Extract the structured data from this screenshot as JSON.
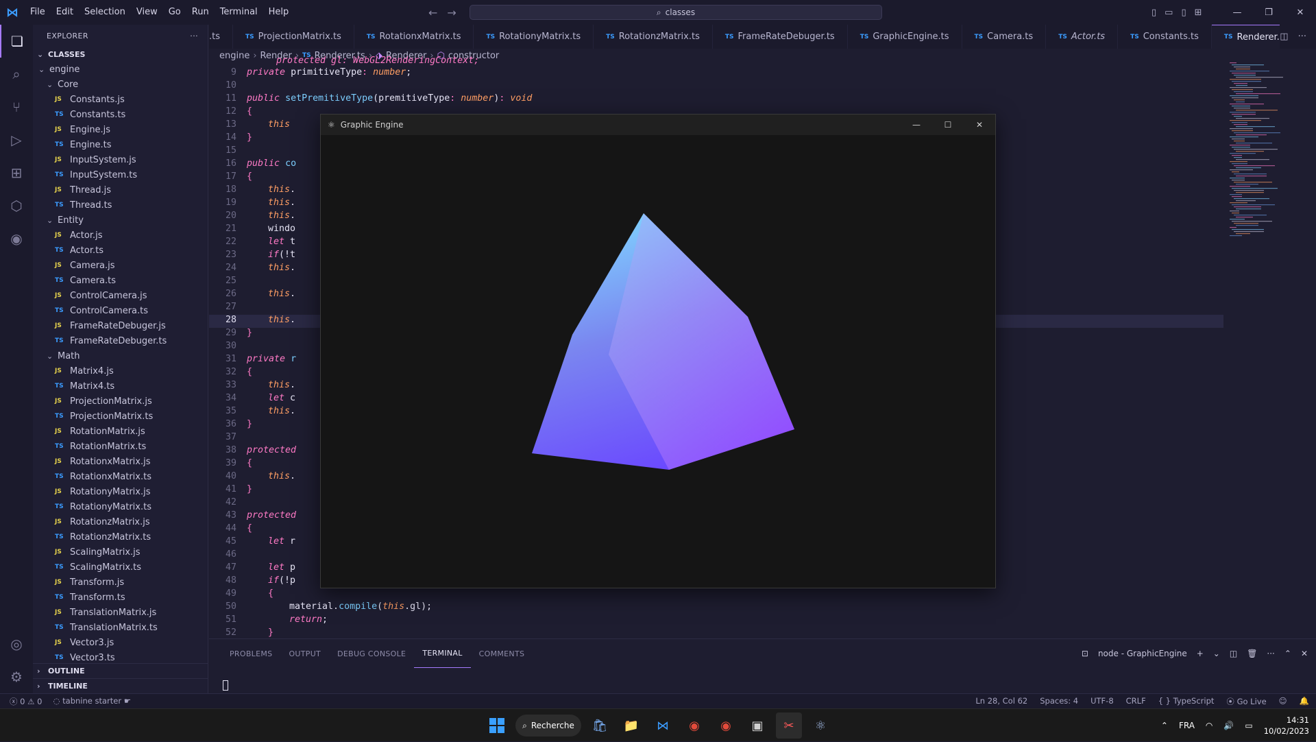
{
  "titlebar": {
    "menu": [
      "File",
      "Edit",
      "Selection",
      "View",
      "Go",
      "Run",
      "Terminal",
      "Help"
    ],
    "search": "classes"
  },
  "sidebar": {
    "title": "EXPLORER",
    "root": "CLASSES",
    "outline": "OUTLINE",
    "timeline": "TIMELINE",
    "tree": [
      {
        "type": "folder",
        "label": "engine",
        "depth": 1
      },
      {
        "type": "folder",
        "label": "Core",
        "depth": 2
      },
      {
        "type": "js",
        "label": "Constants.js",
        "depth": 3
      },
      {
        "type": "ts",
        "label": "Constants.ts",
        "depth": 3
      },
      {
        "type": "js",
        "label": "Engine.js",
        "depth": 3
      },
      {
        "type": "ts",
        "label": "Engine.ts",
        "depth": 3
      },
      {
        "type": "js",
        "label": "InputSystem.js",
        "depth": 3
      },
      {
        "type": "ts",
        "label": "InputSystem.ts",
        "depth": 3
      },
      {
        "type": "js",
        "label": "Thread.js",
        "depth": 3
      },
      {
        "type": "ts",
        "label": "Thread.ts",
        "depth": 3
      },
      {
        "type": "folder",
        "label": "Entity",
        "depth": 2
      },
      {
        "type": "js",
        "label": "Actor.js",
        "depth": 3
      },
      {
        "type": "ts",
        "label": "Actor.ts",
        "depth": 3
      },
      {
        "type": "js",
        "label": "Camera.js",
        "depth": 3
      },
      {
        "type": "ts",
        "label": "Camera.ts",
        "depth": 3
      },
      {
        "type": "js",
        "label": "ControlCamera.js",
        "depth": 3
      },
      {
        "type": "ts",
        "label": "ControlCamera.ts",
        "depth": 3
      },
      {
        "type": "js",
        "label": "FrameRateDebuger.js",
        "depth": 3
      },
      {
        "type": "ts",
        "label": "FrameRateDebuger.ts",
        "depth": 3
      },
      {
        "type": "folder",
        "label": "Math",
        "depth": 2
      },
      {
        "type": "js",
        "label": "Matrix4.js",
        "depth": 3
      },
      {
        "type": "ts",
        "label": "Matrix4.ts",
        "depth": 3
      },
      {
        "type": "js",
        "label": "ProjectionMatrix.js",
        "depth": 3
      },
      {
        "type": "ts",
        "label": "ProjectionMatrix.ts",
        "depth": 3
      },
      {
        "type": "js",
        "label": "RotationMatrix.js",
        "depth": 3
      },
      {
        "type": "ts",
        "label": "RotationMatrix.ts",
        "depth": 3
      },
      {
        "type": "js",
        "label": "RotationxMatrix.js",
        "depth": 3
      },
      {
        "type": "ts",
        "label": "RotationxMatrix.ts",
        "depth": 3
      },
      {
        "type": "js",
        "label": "RotationyMatrix.js",
        "depth": 3
      },
      {
        "type": "ts",
        "label": "RotationyMatrix.ts",
        "depth": 3
      },
      {
        "type": "js",
        "label": "RotationzMatrix.js",
        "depth": 3
      },
      {
        "type": "ts",
        "label": "RotationzMatrix.ts",
        "depth": 3
      },
      {
        "type": "js",
        "label": "ScalingMatrix.js",
        "depth": 3
      },
      {
        "type": "ts",
        "label": "ScalingMatrix.ts",
        "depth": 3
      },
      {
        "type": "js",
        "label": "Transform.js",
        "depth": 3
      },
      {
        "type": "ts",
        "label": "Transform.ts",
        "depth": 3
      },
      {
        "type": "js",
        "label": "TranslationMatrix.js",
        "depth": 3
      },
      {
        "type": "ts",
        "label": "TranslationMatrix.ts",
        "depth": 3
      },
      {
        "type": "js",
        "label": "Vector3.js",
        "depth": 3
      },
      {
        "type": "ts",
        "label": "Vector3.ts",
        "depth": 3
      }
    ]
  },
  "tabs": [
    {
      "label": ".ts",
      "badge": ""
    },
    {
      "label": "ProjectionMatrix.ts",
      "badge": "TS"
    },
    {
      "label": "RotationxMatrix.ts",
      "badge": "TS"
    },
    {
      "label": "RotationyMatrix.ts",
      "badge": "TS"
    },
    {
      "label": "RotationzMatrix.ts",
      "badge": "TS"
    },
    {
      "label": "FrameRateDebuger.ts",
      "badge": "TS"
    },
    {
      "label": "GraphicEngine.ts",
      "badge": "TS"
    },
    {
      "label": "Camera.ts",
      "badge": "TS"
    },
    {
      "label": "Actor.ts",
      "badge": "TS"
    },
    {
      "label": "Constants.ts",
      "badge": "TS"
    },
    {
      "label": "Renderer.ts",
      "badge": "TS",
      "active": true
    }
  ],
  "breadcrumb": {
    "folder1": "engine",
    "folder2": "Render",
    "file": "Renderer.ts",
    "class": "Renderer",
    "member": "constructor"
  },
  "editor": {
    "current_line": 28,
    "lines": [
      {
        "n": 9,
        "html": "<span class='k'>private</span> <span class='tx'>primitiveType</span><span class='pu'>:</span> <span class='tp'>number</span><span class='tx'>;</span>",
        "indent": 1
      },
      {
        "n": 10,
        "html": "",
        "indent": 0
      },
      {
        "n": 11,
        "html": "<span class='k'>public</span> <span class='fn'>setPremitiveType</span><span class='tx'>(</span><span class='tx'>premitiveType</span><span class='pu'>:</span> <span class='tp'>number</span><span class='tx'>)</span><span class='pu'>:</span> <span class='tp'>void</span>",
        "indent": 1
      },
      {
        "n": 12,
        "html": "<span class='pu'>{</span>",
        "indent": 1
      },
      {
        "n": 13,
        "html": "<span class='th'>this</span>",
        "indent": 2
      },
      {
        "n": 14,
        "html": "<span class='pu'>}</span>",
        "indent": 1
      },
      {
        "n": 15,
        "html": "",
        "indent": 0
      },
      {
        "n": 16,
        "html": "<span class='k'>public</span> <span class='fn'>co</span>",
        "indent": 1
      },
      {
        "n": 17,
        "html": "<span class='pu'>{</span>",
        "indent": 1
      },
      {
        "n": 18,
        "html": "<span class='th'>this</span><span class='tx'>.</span>",
        "indent": 2
      },
      {
        "n": 19,
        "html": "<span class='th'>this</span><span class='tx'>.</span>",
        "indent": 2
      },
      {
        "n": 20,
        "html": "<span class='th'>this</span><span class='tx'>.</span>",
        "indent": 2
      },
      {
        "n": 21,
        "html": "<span class='tx'>windo</span>",
        "indent": 2
      },
      {
        "n": 22,
        "html": "<span class='k'>let</span> <span class='tx'>t</span>",
        "indent": 2
      },
      {
        "n": 23,
        "html": "<span class='k'>if</span><span class='tx'>(!t</span>",
        "indent": 2
      },
      {
        "n": 24,
        "html": "<span class='th'>this</span><span class='tx'>.</span>",
        "indent": 2
      },
      {
        "n": 25,
        "html": "",
        "indent": 0
      },
      {
        "n": 26,
        "html": "<span class='th'>this</span><span class='tx'>.</span>",
        "indent": 2
      },
      {
        "n": 27,
        "html": "",
        "indent": 0
      },
      {
        "n": 28,
        "html": "<span class='th'>this</span><span class='tx'>.</span>",
        "indent": 2
      },
      {
        "n": 29,
        "html": "<span class='pu'>}</span>",
        "indent": 1
      },
      {
        "n": 30,
        "html": "",
        "indent": 0
      },
      {
        "n": 31,
        "html": "<span class='k'>private</span> <span class='fn'>r</span>",
        "indent": 1
      },
      {
        "n": 32,
        "html": "<span class='pu'>{</span>",
        "indent": 1
      },
      {
        "n": 33,
        "html": "<span class='th'>this</span><span class='tx'>.</span>",
        "indent": 2
      },
      {
        "n": 34,
        "html": "<span class='k'>let</span> <span class='tx'>c</span>",
        "indent": 2
      },
      {
        "n": 35,
        "html": "<span class='th'>this</span><span class='tx'>.</span>",
        "indent": 2
      },
      {
        "n": 36,
        "html": "<span class='pu'>}</span>",
        "indent": 1
      },
      {
        "n": 37,
        "html": "",
        "indent": 0
      },
      {
        "n": 38,
        "html": "<span class='k'>protected</span>",
        "indent": 1
      },
      {
        "n": 39,
        "html": "<span class='pu'>{</span>",
        "indent": 1
      },
      {
        "n": 40,
        "html": "<span class='th'>this</span><span class='tx'>.</span>",
        "indent": 2
      },
      {
        "n": 41,
        "html": "<span class='pu'>}</span>",
        "indent": 1
      },
      {
        "n": 42,
        "html": "",
        "indent": 0
      },
      {
        "n": 43,
        "html": "<span class='k'>protected</span>",
        "indent": 1
      },
      {
        "n": 44,
        "html": "<span class='pu'>{</span>",
        "indent": 1
      },
      {
        "n": 45,
        "html": "<span class='k'>let</span> <span class='tx'>r</span>",
        "indent": 2
      },
      {
        "n": 46,
        "html": "",
        "indent": 0
      },
      {
        "n": 47,
        "html": "<span class='k'>let</span> <span class='tx'>p</span>",
        "indent": 2
      },
      {
        "n": 48,
        "html": "<span class='k'>if</span><span class='tx'>(!p</span>",
        "indent": 2
      },
      {
        "n": 49,
        "html": "<span class='pu'>{</span>",
        "indent": 2
      },
      {
        "n": 50,
        "html": "<span class='tx'>material</span><span class='tx'>.</span><span class='fn'>compile</span><span class='tx'>(</span><span class='th'>this</span><span class='tx'>.gl);</span>",
        "indent": 3
      },
      {
        "n": 51,
        "html": "<span class='k'>return</span><span class='tx'>;</span>",
        "indent": 3
      },
      {
        "n": 52,
        "html": "<span class='pu'>}</span>",
        "indent": 2
      }
    ]
  },
  "graphic_window": {
    "title": "Graphic Engine"
  },
  "panel": {
    "tabs": [
      "PROBLEMS",
      "OUTPUT",
      "DEBUG CONSOLE",
      "TERMINAL",
      "COMMENTS"
    ],
    "active": "TERMINAL",
    "terminal_name": "node - GraphicEngine"
  },
  "statusbar": {
    "errors": "0",
    "warnings": "0",
    "tabnine": "tabnine starter",
    "position": "Ln 28, Col 62",
    "spaces": "Spaces: 4",
    "encoding": "UTF-8",
    "eol": "CRLF",
    "language": "TypeScript",
    "golive": "Go Live"
  },
  "taskbar": {
    "search": "Recherche",
    "lang": "FRA",
    "time": "14:31",
    "date": "10/02/2023"
  },
  "colors": {
    "accent": "#a77bff",
    "js": "#e8d44d",
    "ts": "#3b9cff"
  }
}
